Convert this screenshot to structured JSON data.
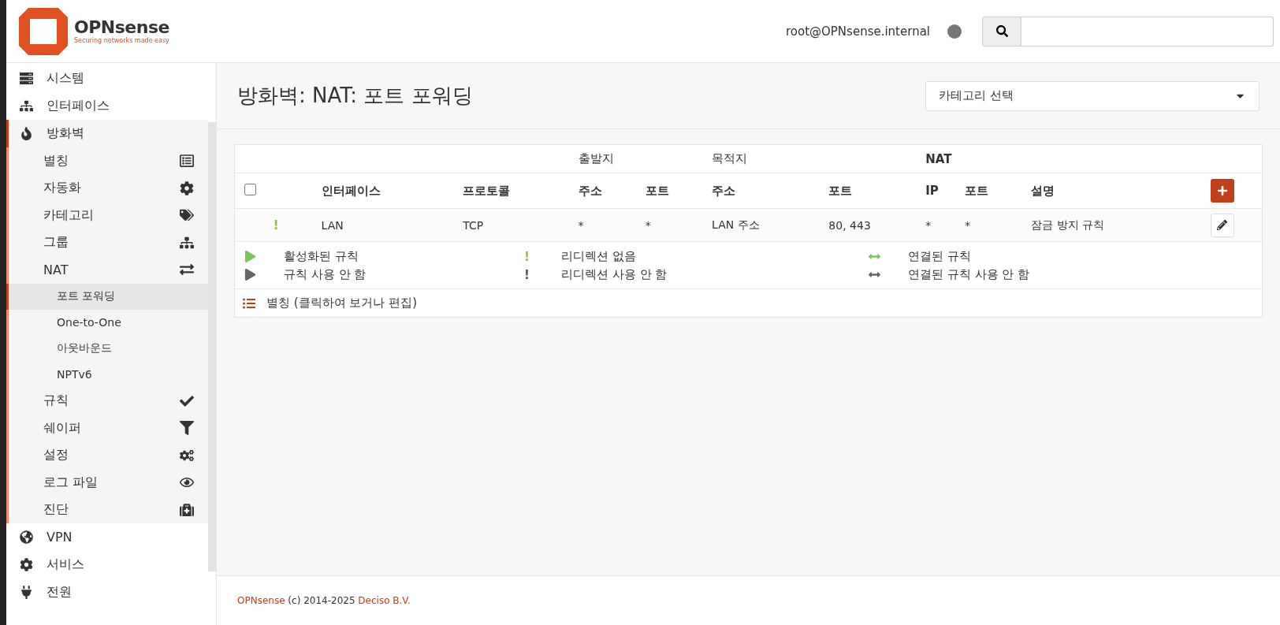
{
  "header": {
    "logo": {
      "name": "OPNsense",
      "tagline": "Securing networks made easy"
    },
    "user": "root@OPNsense.internal",
    "status_dot": {
      "color": "#777777"
    }
  },
  "sidebar": {
    "items": [
      {
        "label": "시스템",
        "selected": false
      },
      {
        "label": "인터페이스",
        "selected": false
      },
      {
        "label": "방화벽",
        "selected": true,
        "expanded": true,
        "children": [
          {
            "label": "별칭",
            "selected": false
          },
          {
            "label": "자동화",
            "selected": false
          },
          {
            "label": "카테고리",
            "selected": false
          },
          {
            "label": "그룹",
            "selected": false
          },
          {
            "label": "NAT",
            "selected": false,
            "expanded": true,
            "children": [
              {
                "label": "포트 포워딩",
                "selected": true
              },
              {
                "label": "One-to-One",
                "selected": false
              },
              {
                "label": "아웃바운드",
                "selected": false
              },
              {
                "label": "NPTv6",
                "selected": false
              }
            ]
          },
          {
            "label": "규칙",
            "selected": false
          },
          {
            "label": "쉐이퍼",
            "selected": false
          },
          {
            "label": "설정",
            "selected": false
          },
          {
            "label": "로그 파일",
            "selected": false
          },
          {
            "label": "진단",
            "selected": false
          }
        ]
      },
      {
        "label": "VPN",
        "selected": false
      },
      {
        "label": "서비스",
        "selected": false
      },
      {
        "label": "전원",
        "selected": false
      }
    ]
  },
  "page": {
    "title": "방화벽: NAT: 포트 포워딩",
    "category_select": {
      "label": "카테고리 선택"
    }
  },
  "table": {
    "column_groups": [
      {
        "label": "출발지"
      },
      {
        "label": "목적지"
      },
      {
        "label": "NAT"
      }
    ],
    "columns": [
      "인터페이스",
      "프로토콜",
      "주소",
      "포트",
      "주소",
      "포트",
      "IP",
      "포트",
      "설명"
    ],
    "select_all": {
      "checked": false
    },
    "rows": [
      {
        "status_mark": "!",
        "enabled": true,
        "cells": [
          "LAN",
          "TCP",
          "*",
          "*",
          "LAN 주소",
          "80, 443",
          "*",
          "*",
          "잠금 방지 규칙"
        ]
      }
    ]
  },
  "legend": [
    {
      "kind": "play",
      "enabled": true,
      "label": "활성화된 규칙"
    },
    {
      "kind": "mark",
      "mark": "!",
      "enabled": true,
      "label": "리디렉션 없음"
    },
    {
      "kind": "link",
      "enabled": true,
      "label": "연결된 규칙"
    },
    {
      "kind": "play",
      "enabled": false,
      "label": "규칙 사용 안 함"
    },
    {
      "kind": "mark",
      "mark": "!",
      "enabled": false,
      "label": "리디렉션 사용 안 함"
    },
    {
      "kind": "link",
      "enabled": false,
      "label": "연결된 규칙 사용 안 함"
    }
  ],
  "alias_link": "별칭 (클릭하여 보거나 편집)",
  "footer": {
    "link_1": "OPNsense",
    "text": " (c) 2014-2025 ",
    "link_2": "Deciso B.V."
  }
}
